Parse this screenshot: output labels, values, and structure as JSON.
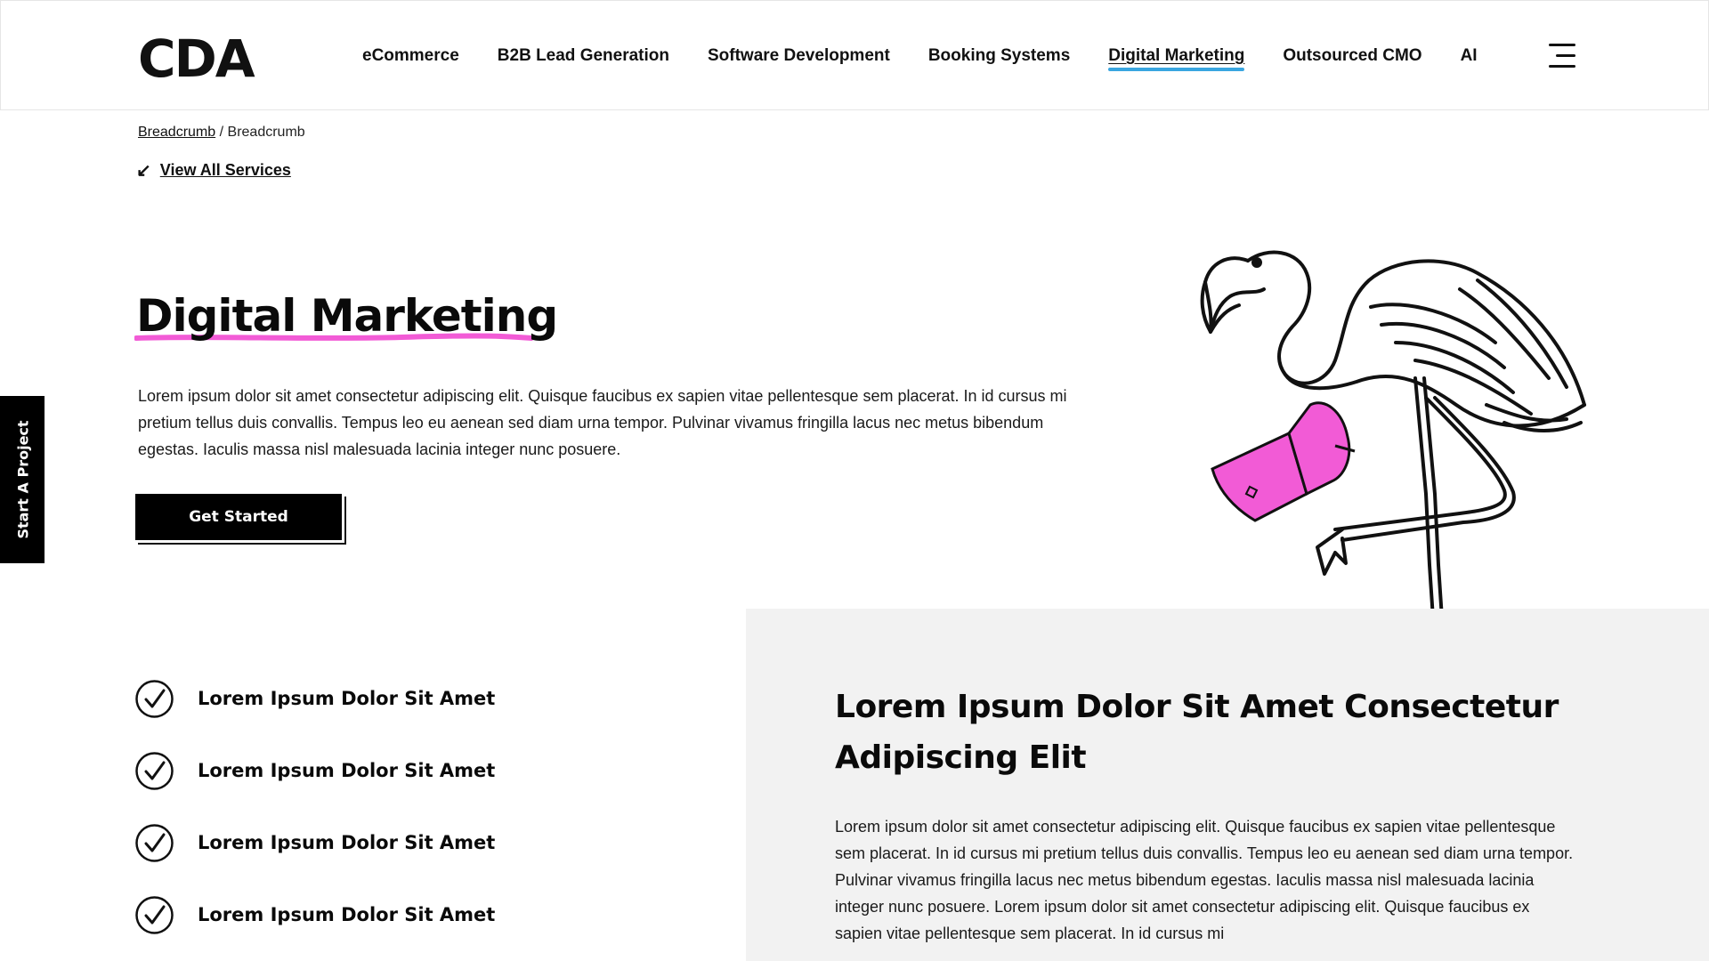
{
  "header": {
    "logo": "CDA",
    "nav": [
      {
        "label": "eCommerce",
        "active": false
      },
      {
        "label": "B2B Lead Generation",
        "active": false
      },
      {
        "label": "Software Development",
        "active": false
      },
      {
        "label": "Booking Systems",
        "active": false
      },
      {
        "label": "Digital Marketing",
        "active": true
      },
      {
        "label": "Outsourced CMO",
        "active": false
      },
      {
        "label": "AI",
        "active": false
      }
    ],
    "menu_icon": "hamburger-icon"
  },
  "breadcrumb": {
    "link_label": "Breadcrumb",
    "separator": "/",
    "current": "Breadcrumb"
  },
  "back_link": {
    "icon": "arrow-down-left-icon",
    "label": "View All Services"
  },
  "hero": {
    "title": "Digital Marketing",
    "body": "Lorem ipsum dolor sit amet consectetur adipiscing elit. Quisque faucibus ex sapien vitae pellentesque sem placerat. In id cursus mi pretium tellus duis convallis. Tempus leo eu aenean sed diam urna tempor. Pulvinar vivamus fringilla lacus nec metus bibendum egestas. Iaculis massa nisl malesuada lacinia integer nunc posuere.",
    "cta_label": "Get Started",
    "illustration": "flamingo-with-megaphone"
  },
  "side_tab": {
    "label": "Start A Project"
  },
  "checklist": {
    "icon": "check-circle-icon",
    "items": [
      "Lorem Ipsum Dolor Sit Amet",
      "Lorem Ipsum Dolor Sit Amet",
      "Lorem Ipsum Dolor Sit Amet",
      "Lorem Ipsum Dolor Sit Amet"
    ]
  },
  "panel": {
    "title": "Lorem Ipsum Dolor Sit Amet Consectetur Adipiscing Elit",
    "body": "Lorem ipsum dolor sit amet consectetur adipiscing elit. Quisque faucibus ex sapien vitae pellentesque sem placerat. In id cursus mi pretium tellus duis convallis. Tempus leo eu aenean sed diam urna tempor. Pulvinar vivamus fringilla lacus nec metus bibendum egestas. Iaculis massa nisl malesuada lacinia integer nunc posuere. Lorem ipsum dolor sit amet consectetur adipiscing elit. Quisque faucibus ex sapien vitae pellentesque sem placerat. In id cursus mi"
  },
  "colors": {
    "accent_pink": "#f25bd6",
    "nav_underline_blue": "#3aa6e0",
    "panel_gray": "#f2f2f2",
    "text": "#111111"
  }
}
